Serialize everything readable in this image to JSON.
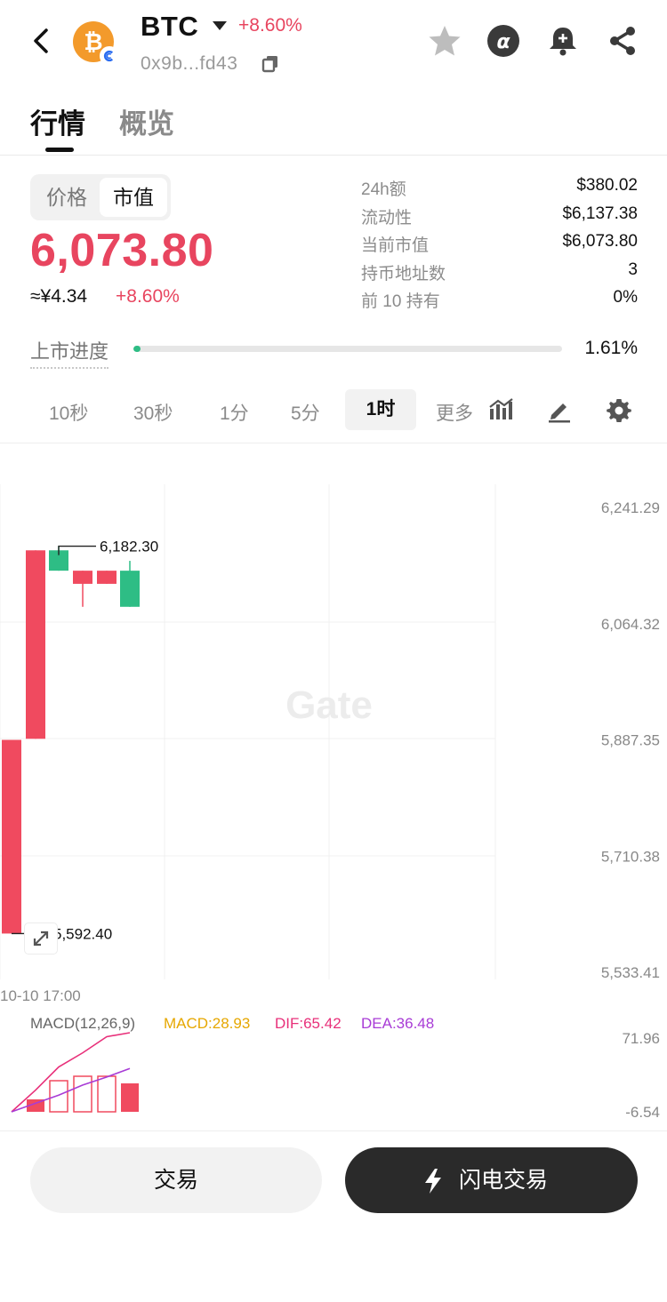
{
  "header": {
    "symbol": "BTC",
    "change_pct": "+8.60%",
    "address": "0x9b...fd43"
  },
  "tabs": [
    {
      "label": "行情",
      "active": true
    },
    {
      "label": "概览",
      "active": false
    }
  ],
  "price_toggle": {
    "options": [
      "价格",
      "市值"
    ],
    "selected": "市值"
  },
  "price": {
    "value": "6,073.80",
    "cny": "≈¥4.34",
    "change_pct": "+8.60%"
  },
  "stats": [
    {
      "label": "24h额",
      "value": "$380.02"
    },
    {
      "label": "流动性",
      "value": "$6,137.38"
    },
    {
      "label": "当前市值",
      "value": "$6,073.80"
    },
    {
      "label": "持币地址数",
      "value": "3"
    },
    {
      "label": "前 10 持有",
      "value": "0%"
    }
  ],
  "listing_progress": {
    "label": "上市进度",
    "value": "1.61%",
    "fraction": 0.0161
  },
  "intervals": [
    "10秒",
    "30秒",
    "1分",
    "5分",
    "1时",
    "更多"
  ],
  "selected_interval": "1时",
  "chart_data": {
    "type": "candlestick",
    "y_ticks": [
      "6,241.29",
      "6,064.32",
      "5,887.35",
      "5,710.38",
      "5,533.41"
    ],
    "ylim": [
      5533.41,
      6241.29
    ],
    "x_tick": "10-10 17:00",
    "high_label": "6,182.30",
    "low_label": "5,592.40",
    "watermark": "Gate",
    "candles": [
      {
        "open": 5887.35,
        "high": 5887.35,
        "low": 5592.4,
        "close": 5592.4
      },
      {
        "open": 6176.0,
        "high": 6176.0,
        "low": 5889.0,
        "close": 5889.0
      },
      {
        "open": 6145.0,
        "high": 6182.3,
        "low": 6145.0,
        "close": 6176.0
      },
      {
        "open": 6145.0,
        "high": 6145.0,
        "low": 6090.0,
        "close": 6125.0
      },
      {
        "open": 6145.0,
        "high": 6145.0,
        "low": 6125.0,
        "close": 6125.0
      },
      {
        "open": 6090.0,
        "high": 6160.0,
        "low": 6090.0,
        "close": 6145.0
      }
    ]
  },
  "macd": {
    "title": "MACD(12,26,9)",
    "macd": "MACD:28.93",
    "dif": "DIF:65.42",
    "dea": "DEA:36.48",
    "y_top": "71.96",
    "y_bottom": "-6.54",
    "histogram": [
      0,
      14,
      35,
      40,
      40,
      32
    ],
    "dif_values": [
      -6.54,
      15,
      38,
      52,
      68,
      71.96
    ],
    "dea_values": [
      -6.54,
      2,
      10,
      20,
      28,
      36.48
    ]
  },
  "colors": {
    "up": "#2ebd85",
    "down": "#f04a5f",
    "accent_red": "#e8455f",
    "macd": "#e6a700",
    "dif": "#e8307a",
    "dea": "#a83cd6"
  },
  "buttons": {
    "trade": "交易",
    "flash_trade": "闪电交易"
  }
}
